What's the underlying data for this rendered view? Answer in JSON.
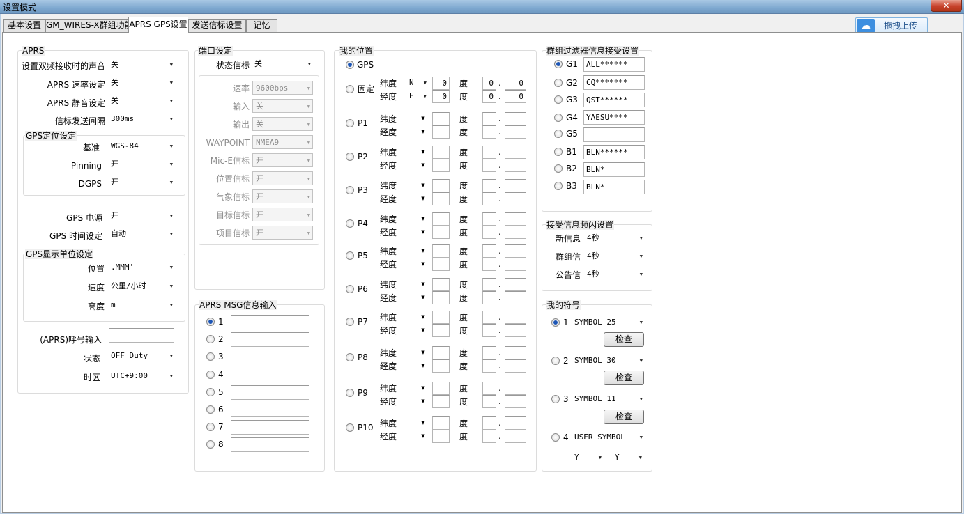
{
  "window": {
    "title": "设置模式",
    "close_label": "✕"
  },
  "tabs": [
    "基本设置",
    "GM_WIRES-X群组功能",
    "APRS GPS设置",
    "发送信标设置",
    "记忆"
  ],
  "upload_button": {
    "label": "拖拽上传"
  },
  "aprs": {
    "title": "APRS",
    "rows": [
      {
        "label": "设置双频接收时的声音",
        "value": "关"
      },
      {
        "label": "APRS 速率设定",
        "value": "关"
      },
      {
        "label": "APRS 静音设定",
        "value": "关"
      },
      {
        "label": "信标发送间隔",
        "value": "300ms"
      }
    ],
    "gps_pos": {
      "title": "GPS定位设定",
      "rows": [
        {
          "label": "基准",
          "value": "WGS-84"
        },
        {
          "label": "Pinning",
          "value": "开"
        },
        {
          "label": "DGPS",
          "value": "开"
        }
      ]
    },
    "gps_power": {
      "label": "GPS 电源",
      "value": "开"
    },
    "gps_time": {
      "label": "GPS 时间设定",
      "value": "自动"
    },
    "gps_units": {
      "title": "GPS显示单位设定",
      "rows": [
        {
          "label": "位置",
          "value": ".MMM'"
        },
        {
          "label": "速度",
          "value": "公里/小时"
        },
        {
          "label": "高度",
          "value": "m"
        }
      ]
    },
    "callsign": {
      "label": "(APRS)呼号输入",
      "value": ""
    },
    "status": {
      "label": "状态",
      "value": "OFF Duty"
    },
    "timezone": {
      "label": "时区",
      "value": "UTC+9:00"
    }
  },
  "port": {
    "title": "端口设定",
    "status_beacon": {
      "label": "状态信标",
      "value": "关"
    },
    "rows": [
      {
        "label": "速率",
        "value": "9600bps"
      },
      {
        "label": "输入",
        "value": "关"
      },
      {
        "label": "输出",
        "value": "关"
      },
      {
        "label": "WAYPOINT",
        "value": "NMEA9"
      },
      {
        "label": "Mic-E信标",
        "value": "开"
      },
      {
        "label": "位置信标",
        "value": "开"
      },
      {
        "label": "气象信标",
        "value": "开"
      },
      {
        "label": "目标信标",
        "value": "开"
      },
      {
        "label": "项目信标",
        "value": "开"
      }
    ]
  },
  "msg": {
    "title": "APRS MSG信息输入",
    "items": [
      {
        "label": "1",
        "value": ""
      },
      {
        "label": "2",
        "value": ""
      },
      {
        "label": "3",
        "value": ""
      },
      {
        "label": "4",
        "value": ""
      },
      {
        "label": "5",
        "value": ""
      },
      {
        "label": "6",
        "value": ""
      },
      {
        "label": "7",
        "value": ""
      },
      {
        "label": "8",
        "value": ""
      }
    ]
  },
  "position": {
    "title": "我的位置",
    "gps_label": "GPS",
    "lat_label": "纬度",
    "lon_label": "经度",
    "deg_label": "度",
    "dot_label": ".",
    "fixed": {
      "label": "固定",
      "lat_dir": "N",
      "lat_deg": "0",
      "lat_min": "0",
      "lat_sec": "0",
      "lon_dir": "E",
      "lon_deg": "0",
      "lon_min": "0",
      "lon_sec": "0"
    },
    "presets": [
      "P1",
      "P2",
      "P3",
      "P4",
      "P5",
      "P6",
      "P7",
      "P8",
      "P9",
      "P10"
    ]
  },
  "group_filter": {
    "title": "群组过滤器信息接受设置",
    "items": [
      {
        "label": "G1",
        "value": "ALL******"
      },
      {
        "label": "G2",
        "value": "CQ*******"
      },
      {
        "label": "G3",
        "value": "QST******"
      },
      {
        "label": "G4",
        "value": "YAESU****"
      },
      {
        "label": "G5",
        "value": ""
      },
      {
        "label": "B1",
        "value": "BLN******"
      },
      {
        "label": "B2",
        "value": "BLN*"
      },
      {
        "label": "B3",
        "value": "BLN*"
      }
    ]
  },
  "flash": {
    "title": "接受信息频闪设置",
    "rows": [
      {
        "label": "新信息",
        "value": "4秒"
      },
      {
        "label": "群组信",
        "value": "4秒"
      },
      {
        "label": "公告信",
        "value": "4秒"
      }
    ]
  },
  "symbol": {
    "title": "我的符号",
    "check_label": "检查",
    "items": [
      {
        "label": "1",
        "value": "SYMBOL 25"
      },
      {
        "label": "2",
        "value": "SYMBOL 30"
      },
      {
        "label": "3",
        "value": "SYMBOL 11"
      },
      {
        "label": "4",
        "value": "USER SYMBOL"
      }
    ],
    "user_a": "Y",
    "user_b": "Y"
  }
}
